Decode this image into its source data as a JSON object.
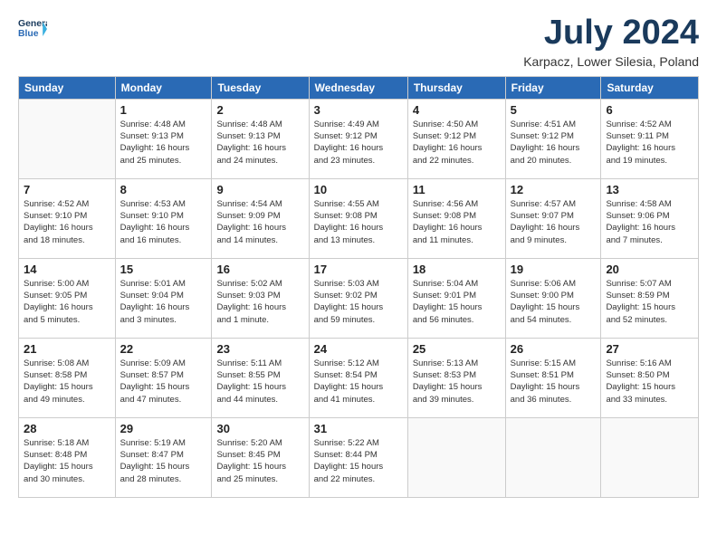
{
  "header": {
    "logo_line1": "General",
    "logo_line2": "Blue",
    "month": "July 2024",
    "location": "Karpacz, Lower Silesia, Poland"
  },
  "weekdays": [
    "Sunday",
    "Monday",
    "Tuesday",
    "Wednesday",
    "Thursday",
    "Friday",
    "Saturday"
  ],
  "weeks": [
    [
      {
        "day": "",
        "info": ""
      },
      {
        "day": "1",
        "info": "Sunrise: 4:48 AM\nSunset: 9:13 PM\nDaylight: 16 hours\nand 25 minutes."
      },
      {
        "day": "2",
        "info": "Sunrise: 4:48 AM\nSunset: 9:13 PM\nDaylight: 16 hours\nand 24 minutes."
      },
      {
        "day": "3",
        "info": "Sunrise: 4:49 AM\nSunset: 9:12 PM\nDaylight: 16 hours\nand 23 minutes."
      },
      {
        "day": "4",
        "info": "Sunrise: 4:50 AM\nSunset: 9:12 PM\nDaylight: 16 hours\nand 22 minutes."
      },
      {
        "day": "5",
        "info": "Sunrise: 4:51 AM\nSunset: 9:12 PM\nDaylight: 16 hours\nand 20 minutes."
      },
      {
        "day": "6",
        "info": "Sunrise: 4:52 AM\nSunset: 9:11 PM\nDaylight: 16 hours\nand 19 minutes."
      }
    ],
    [
      {
        "day": "7",
        "info": "Sunrise: 4:52 AM\nSunset: 9:10 PM\nDaylight: 16 hours\nand 18 minutes."
      },
      {
        "day": "8",
        "info": "Sunrise: 4:53 AM\nSunset: 9:10 PM\nDaylight: 16 hours\nand 16 minutes."
      },
      {
        "day": "9",
        "info": "Sunrise: 4:54 AM\nSunset: 9:09 PM\nDaylight: 16 hours\nand 14 minutes."
      },
      {
        "day": "10",
        "info": "Sunrise: 4:55 AM\nSunset: 9:08 PM\nDaylight: 16 hours\nand 13 minutes."
      },
      {
        "day": "11",
        "info": "Sunrise: 4:56 AM\nSunset: 9:08 PM\nDaylight: 16 hours\nand 11 minutes."
      },
      {
        "day": "12",
        "info": "Sunrise: 4:57 AM\nSunset: 9:07 PM\nDaylight: 16 hours\nand 9 minutes."
      },
      {
        "day": "13",
        "info": "Sunrise: 4:58 AM\nSunset: 9:06 PM\nDaylight: 16 hours\nand 7 minutes."
      }
    ],
    [
      {
        "day": "14",
        "info": "Sunrise: 5:00 AM\nSunset: 9:05 PM\nDaylight: 16 hours\nand 5 minutes."
      },
      {
        "day": "15",
        "info": "Sunrise: 5:01 AM\nSunset: 9:04 PM\nDaylight: 16 hours\nand 3 minutes."
      },
      {
        "day": "16",
        "info": "Sunrise: 5:02 AM\nSunset: 9:03 PM\nDaylight: 16 hours\nand 1 minute."
      },
      {
        "day": "17",
        "info": "Sunrise: 5:03 AM\nSunset: 9:02 PM\nDaylight: 15 hours\nand 59 minutes."
      },
      {
        "day": "18",
        "info": "Sunrise: 5:04 AM\nSunset: 9:01 PM\nDaylight: 15 hours\nand 56 minutes."
      },
      {
        "day": "19",
        "info": "Sunrise: 5:06 AM\nSunset: 9:00 PM\nDaylight: 15 hours\nand 54 minutes."
      },
      {
        "day": "20",
        "info": "Sunrise: 5:07 AM\nSunset: 8:59 PM\nDaylight: 15 hours\nand 52 minutes."
      }
    ],
    [
      {
        "day": "21",
        "info": "Sunrise: 5:08 AM\nSunset: 8:58 PM\nDaylight: 15 hours\nand 49 minutes."
      },
      {
        "day": "22",
        "info": "Sunrise: 5:09 AM\nSunset: 8:57 PM\nDaylight: 15 hours\nand 47 minutes."
      },
      {
        "day": "23",
        "info": "Sunrise: 5:11 AM\nSunset: 8:55 PM\nDaylight: 15 hours\nand 44 minutes."
      },
      {
        "day": "24",
        "info": "Sunrise: 5:12 AM\nSunset: 8:54 PM\nDaylight: 15 hours\nand 41 minutes."
      },
      {
        "day": "25",
        "info": "Sunrise: 5:13 AM\nSunset: 8:53 PM\nDaylight: 15 hours\nand 39 minutes."
      },
      {
        "day": "26",
        "info": "Sunrise: 5:15 AM\nSunset: 8:51 PM\nDaylight: 15 hours\nand 36 minutes."
      },
      {
        "day": "27",
        "info": "Sunrise: 5:16 AM\nSunset: 8:50 PM\nDaylight: 15 hours\nand 33 minutes."
      }
    ],
    [
      {
        "day": "28",
        "info": "Sunrise: 5:18 AM\nSunset: 8:48 PM\nDaylight: 15 hours\nand 30 minutes."
      },
      {
        "day": "29",
        "info": "Sunrise: 5:19 AM\nSunset: 8:47 PM\nDaylight: 15 hours\nand 28 minutes."
      },
      {
        "day": "30",
        "info": "Sunrise: 5:20 AM\nSunset: 8:45 PM\nDaylight: 15 hours\nand 25 minutes."
      },
      {
        "day": "31",
        "info": "Sunrise: 5:22 AM\nSunset: 8:44 PM\nDaylight: 15 hours\nand 22 minutes."
      },
      {
        "day": "",
        "info": ""
      },
      {
        "day": "",
        "info": ""
      },
      {
        "day": "",
        "info": ""
      }
    ]
  ]
}
